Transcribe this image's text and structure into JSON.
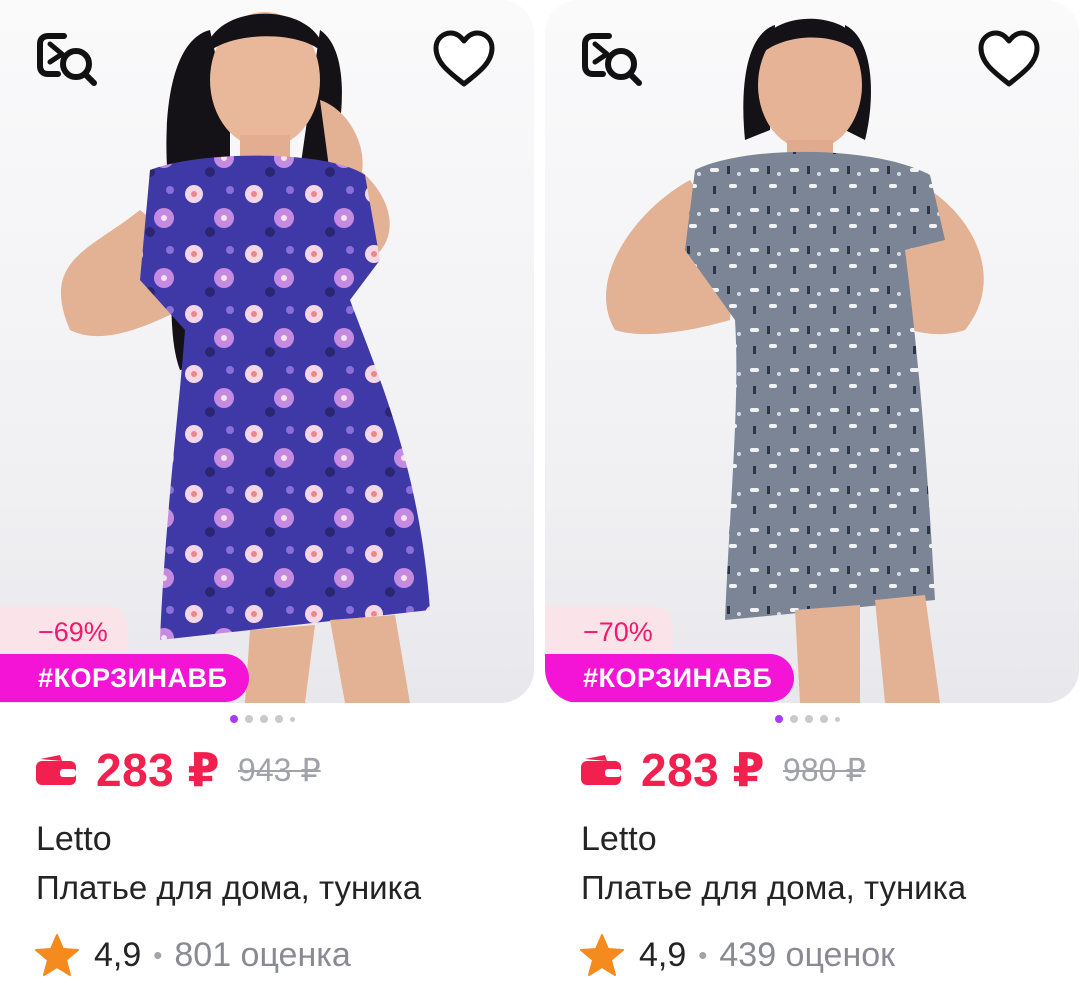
{
  "products": [
    {
      "discount": "−69%",
      "promo_tag": "#КОРЗИНАВБ",
      "price": "283 ₽",
      "old_price": "943 ₽",
      "brand": "Letto",
      "title": "Платье для дома, туника",
      "rating": "4,9",
      "reviews": "801 оценка",
      "dress_color": "#4a3fb0",
      "image_dots": 5,
      "active_dot": 0
    },
    {
      "discount": "−70%",
      "promo_tag": "#КОРЗИНАВБ",
      "price": "283 ₽",
      "old_price": "980 ₽",
      "brand": "Letto",
      "title": "Платье для дома, туника",
      "rating": "4,9",
      "reviews": "439 оценок",
      "dress_color": "#7b8596",
      "image_dots": 5,
      "active_dot": 0
    }
  ],
  "icons": {
    "zoom": "image-search-icon",
    "favorite": "heart-icon",
    "wallet": "wallet-icon",
    "star": "star-icon"
  },
  "colors": {
    "price": "#f2204f",
    "promo": "#f414d6",
    "discount_text": "#f3176d",
    "star": "#f58a1f",
    "dot_active": "#a73afd"
  }
}
